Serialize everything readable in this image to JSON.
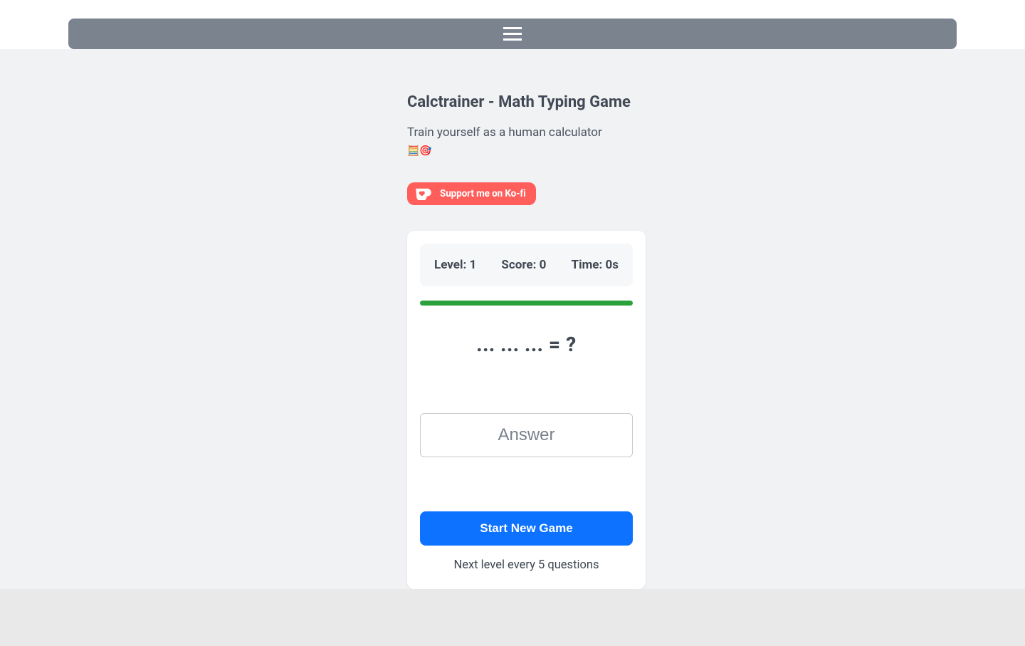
{
  "page": {
    "title": "Calctrainer - Math Typing Game",
    "subtitle": "Train yourself as a human calculator",
    "emoji": "🧮🎯"
  },
  "kofi": {
    "label": "Support me on Ko-fi"
  },
  "game": {
    "level_label": "Level: 1",
    "score_label": "Score: 0",
    "time_label": "Time: 0s",
    "equation": "... ... ... = ?",
    "answer_placeholder": "Answer",
    "start_label": "Start New Game",
    "hint": "Next level every 5 questions"
  }
}
